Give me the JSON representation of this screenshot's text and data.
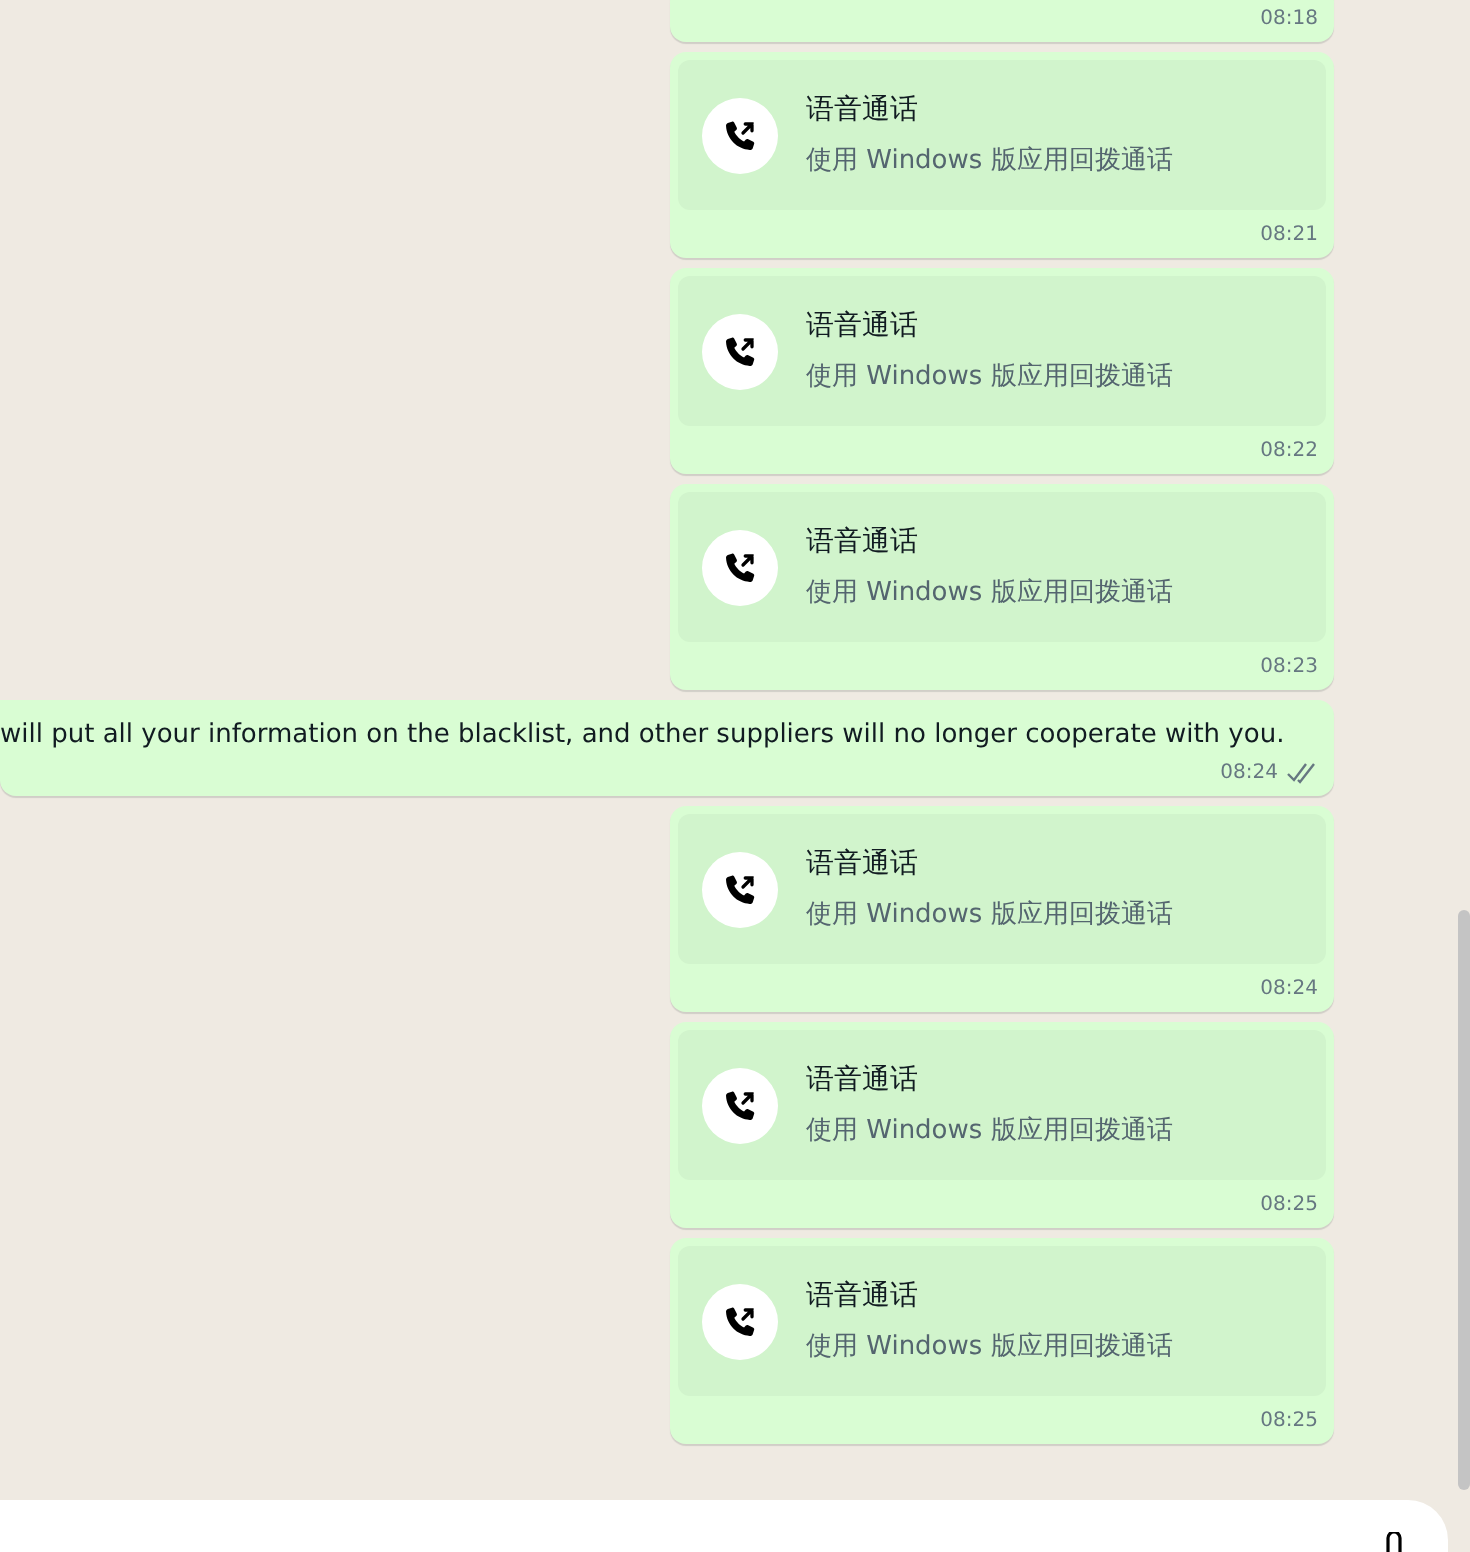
{
  "messages": [
    {
      "kind": "call_cut",
      "time": "08:18"
    },
    {
      "kind": "call",
      "title": "语音通话",
      "subtitle": "使用 Windows 版应用回拨通话",
      "time": "08:21"
    },
    {
      "kind": "call",
      "title": "语音通话",
      "subtitle": "使用 Windows 版应用回拨通话",
      "time": "08:22"
    },
    {
      "kind": "call",
      "title": "语音通话",
      "subtitle": "使用 Windows 版应用回拨通话",
      "time": "08:23"
    },
    {
      "kind": "text",
      "text": "will put all your information on the blacklist, and other suppliers will no longer cooperate with you.",
      "time": "08:24",
      "read": false
    },
    {
      "kind": "call",
      "title": "语音通话",
      "subtitle": "使用 Windows 版应用回拨通话",
      "time": "08:24"
    },
    {
      "kind": "call",
      "title": "语音通话",
      "subtitle": "使用 Windows 版应用回拨通话",
      "time": "08:25"
    },
    {
      "kind": "call",
      "title": "语音通话",
      "subtitle": "使用 Windows 版应用回拨通话",
      "time": "08:25"
    }
  ]
}
